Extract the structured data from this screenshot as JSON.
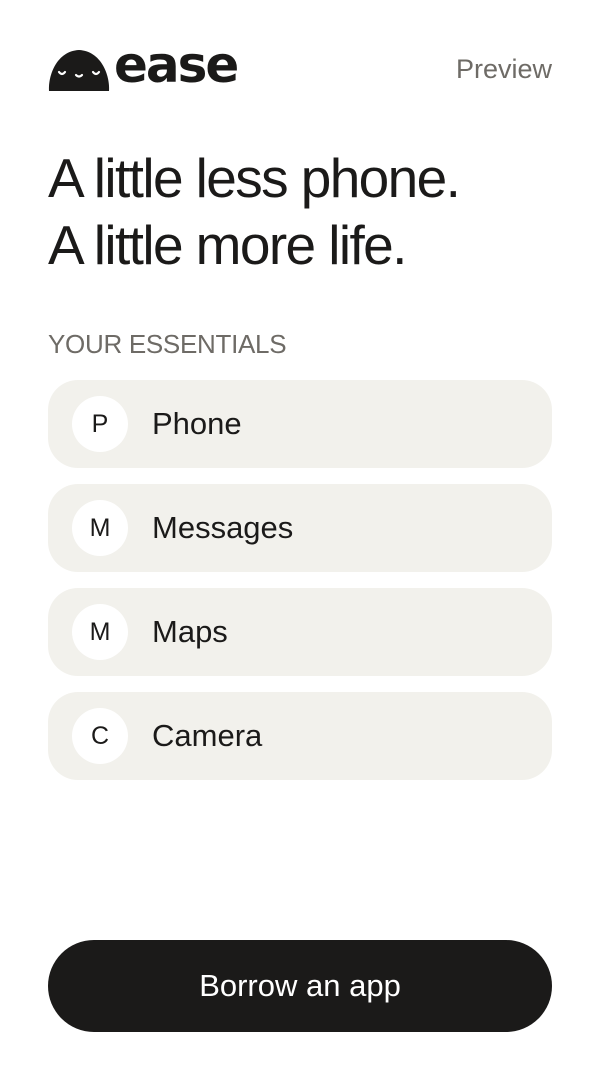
{
  "header": {
    "logo_text": "ease",
    "logo_icon": "sleepy-face-blob-icon",
    "preview_label": "Preview"
  },
  "hero": {
    "line1": "A little less phone.",
    "line2": "A little more life."
  },
  "essentials": {
    "section_label": "YOUR ESSENTIALS",
    "items": [
      {
        "initial": "P",
        "label": "Phone"
      },
      {
        "initial": "M",
        "label": "Messages"
      },
      {
        "initial": "M",
        "label": "Maps"
      },
      {
        "initial": "C",
        "label": "Camera"
      }
    ]
  },
  "actions": {
    "borrow_label": "Borrow an app"
  },
  "colors": {
    "text": "#1b1a19",
    "muted": "#6e6b66",
    "card": "#f2f1ec",
    "button": "#1b1a19",
    "button_text": "#ffffff",
    "background": "#ffffff"
  }
}
